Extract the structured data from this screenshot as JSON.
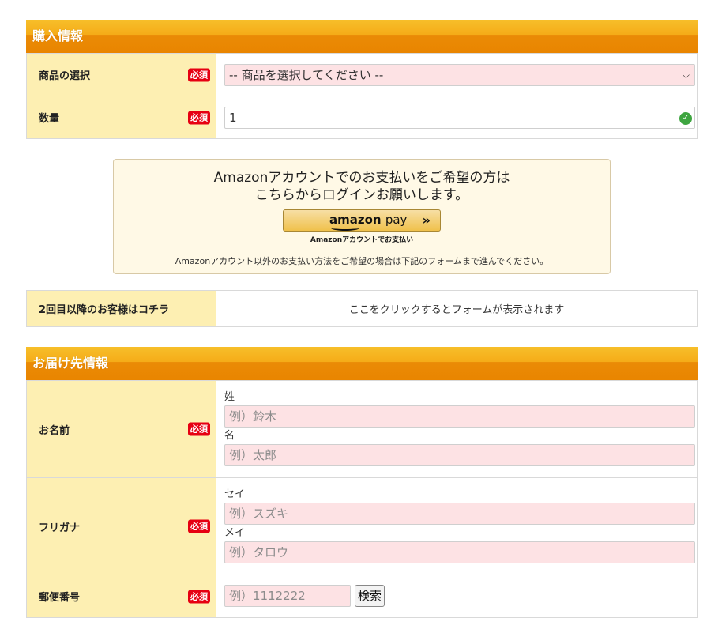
{
  "purchase": {
    "header": "購入情報",
    "required_badge": "必須",
    "product": {
      "label": "商品の選択",
      "selected": "-- 商品を選択してください --"
    },
    "quantity": {
      "label": "数量",
      "value": "1"
    }
  },
  "amazon": {
    "message_line1": "Amazonアカウントでのお支払いをご希望の方は",
    "message_line2": "こちらからログインお願いします。",
    "button_brand": "amazon",
    "button_pay": "pay",
    "button_chevron": "»",
    "caption": "Amazonアカウントでお支払い",
    "note": "Amazonアカウント以外のお支払い方法をご希望の場合は下記のフォームまで進んでください。"
  },
  "repeat": {
    "label": "2回目以降のお客様はコチラ",
    "text": "ここをクリックするとフォームが表示されます"
  },
  "delivery": {
    "header": "お届け先情報",
    "name": {
      "label": "お名前",
      "last_label": "姓",
      "last_placeholder": "例）鈴木",
      "first_label": "名",
      "first_placeholder": "例）太郎"
    },
    "furigana": {
      "label": "フリガナ",
      "last_label": "セイ",
      "last_placeholder": "例）スズキ",
      "first_label": "メイ",
      "first_placeholder": "例）タロウ"
    },
    "postal": {
      "label": "郵便番号",
      "placeholder": "例）1112222",
      "search_button": "検索"
    }
  },
  "colors": {
    "header_orange": "#ea8b06",
    "label_bg": "#fdefb2",
    "required_red": "#e60012",
    "input_pink": "#fde2e4"
  }
}
